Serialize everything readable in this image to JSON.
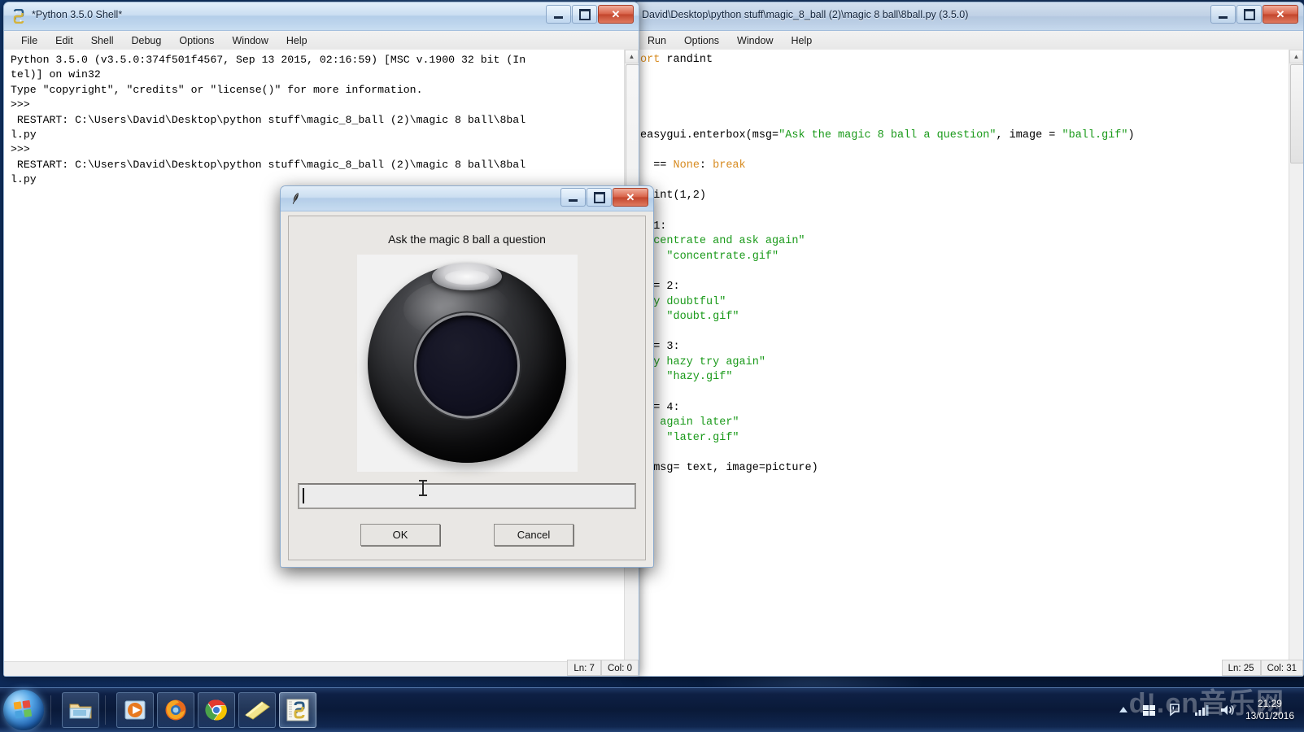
{
  "desktop": {
    "taskbar": {
      "start_label": "Start",
      "items": [
        {
          "name": "explorer",
          "label": "Windows Explorer"
        },
        {
          "name": "media-player",
          "label": "Windows Media Player"
        },
        {
          "name": "firefox",
          "label": "Mozilla Firefox"
        },
        {
          "name": "chrome",
          "label": "Google Chrome"
        },
        {
          "name": "notes",
          "label": "Sticky Notes"
        },
        {
          "name": "python-idle",
          "label": "Python IDLE"
        }
      ],
      "tray": [
        {
          "name": "show-hidden-icons",
          "glyph": "▲"
        },
        {
          "name": "windows-flag",
          "glyph": "flag"
        },
        {
          "name": "action-center",
          "glyph": "flag-alert"
        },
        {
          "name": "network",
          "glyph": "bars"
        },
        {
          "name": "volume",
          "glyph": "speaker"
        }
      ],
      "clock_time": "21:29",
      "clock_date": "13/01/2016"
    },
    "watermark": "d!.cn音乐网"
  },
  "shell_window": {
    "title": "*Python 3.5.0 Shell*",
    "icon": "python-idle-icon",
    "menu": [
      "File",
      "Edit",
      "Shell",
      "Debug",
      "Options",
      "Window",
      "Help"
    ],
    "buttons": {
      "minimize": "–",
      "maximize": "□",
      "close": "✕"
    },
    "content": "Python 3.5.0 (v3.5.0:374f501f4567, Sep 13 2015, 02:16:59) [MSC v.1900 32 bit (In\ntel)] on win32\nType \"copyright\", \"credits\" or \"license()\" for more information.\n>>> \n RESTART: C:\\Users\\David\\Desktop\\python stuff\\magic_8_ball (2)\\magic 8 ball\\8bal\nl.py \n>>> \n RESTART: C:\\Users\\David\\Desktop\\python stuff\\magic_8_ball (2)\\magic 8 ball\\8bal\nl.py ",
    "status": {
      "line": "Ln: 7",
      "col": "Col: 0"
    }
  },
  "editor_window": {
    "title": "David\\Desktop\\python stuff\\magic_8_ball (2)\\magic 8 ball\\8ball.py (3.5.0)",
    "menu": [
      "Run",
      "Options",
      "Window",
      "Help"
    ],
    "buttons": {
      "minimize": "–",
      "maximize": "□",
      "close": "✕"
    },
    "code_lines": [
      {
        "indent": 0,
        "segments": [
          {
            "t": "ort ",
            "c": "kw"
          },
          {
            "t": "randint",
            "c": "plain"
          }
        ]
      },
      {
        "indent": 0,
        "segments": []
      },
      {
        "indent": 0,
        "segments": []
      },
      {
        "indent": 0,
        "segments": []
      },
      {
        "indent": 0,
        "segments": []
      },
      {
        "indent": 0,
        "segments": [
          {
            "t": "easygui.enterbox(msg=",
            "c": "plain"
          },
          {
            "t": "\"Ask the magic 8 ball a question\"",
            "c": "str"
          },
          {
            "t": ", image = ",
            "c": "plain"
          },
          {
            "t": "\"ball.gif\"",
            "c": "str"
          },
          {
            "t": ")",
            "c": "plain"
          }
        ]
      },
      {
        "indent": 0,
        "segments": []
      },
      {
        "indent": 1,
        "segments": [
          {
            "t": "== ",
            "c": "plain"
          },
          {
            "t": "None",
            "c": "kw"
          },
          {
            "t": ": ",
            "c": "plain"
          },
          {
            "t": "break",
            "c": "kw"
          }
        ]
      },
      {
        "indent": 0,
        "segments": []
      },
      {
        "indent": 1,
        "segments": [
          {
            "t": "int(1,2)",
            "c": "plain"
          }
        ]
      },
      {
        "indent": 0,
        "segments": []
      },
      {
        "indent": 1,
        "segments": [
          {
            "t": "1:",
            "c": "plain"
          }
        ]
      },
      {
        "indent": 0,
        "segments": [
          {
            "t": "oncentrate and ask again\"",
            "c": "str"
          }
        ]
      },
      {
        "indent": 2,
        "segments": [
          {
            "t": "\"concentrate.gif\"",
            "c": "str"
          }
        ]
      },
      {
        "indent": 0,
        "segments": []
      },
      {
        "indent": 1,
        "segments": [
          {
            "t": "= 2:",
            "c": "plain"
          }
        ]
      },
      {
        "indent": 0,
        "segments": [
          {
            "t": "ery doubtful\"",
            "c": "str"
          }
        ]
      },
      {
        "indent": 2,
        "segments": [
          {
            "t": "\"doubt.gif\"",
            "c": "str"
          }
        ]
      },
      {
        "indent": 0,
        "segments": []
      },
      {
        "indent": 1,
        "segments": [
          {
            "t": "= 3:",
            "c": "plain"
          }
        ]
      },
      {
        "indent": 0,
        "segments": [
          {
            "t": "ery hazy try again\"",
            "c": "str"
          }
        ]
      },
      {
        "indent": 2,
        "segments": [
          {
            "t": "\"hazy.gif\"",
            "c": "str"
          }
        ]
      },
      {
        "indent": 0,
        "segments": []
      },
      {
        "indent": 1,
        "segments": [
          {
            "t": "= 4:",
            "c": "plain"
          }
        ]
      },
      {
        "indent": 0,
        "segments": [
          {
            "t": "sk again later\"",
            "c": "str"
          }
        ]
      },
      {
        "indent": 2,
        "segments": [
          {
            "t": "\"later.gif\"",
            "c": "str"
          }
        ]
      },
      {
        "indent": 0,
        "segments": []
      },
      {
        "indent": 0,
        "segments": [
          {
            "t": "x(msg= text, image=picture)",
            "c": "plain"
          }
        ]
      }
    ],
    "status": {
      "line": "Ln: 25",
      "col": "Col: 31"
    }
  },
  "dialog": {
    "icon": "tk-feather-icon",
    "title": "",
    "message": "Ask the magic 8 ball a question",
    "image_name": "magic-8-ball-image",
    "input_value": "",
    "buttons": {
      "ok": "OK",
      "cancel": "Cancel"
    },
    "window_buttons": {
      "minimize": "–",
      "maximize": "□",
      "close": "✕"
    }
  },
  "colors": {
    "accent": "#1d5fae",
    "string_green": "#1a9a1a",
    "keyword_orange": "#d78b20",
    "close_red": "#c2452c"
  }
}
